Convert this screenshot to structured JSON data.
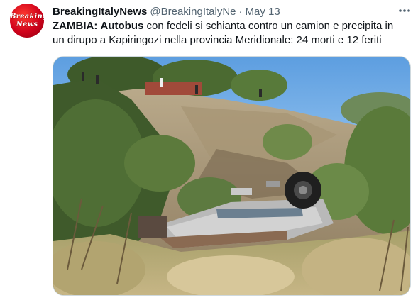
{
  "tweet": {
    "avatar": {
      "line1": "Breaking",
      "line2": "News",
      "color": "#d0021b"
    },
    "display_name": "BreakingItalyNews",
    "handle": "@BreakingItalyNe",
    "separator": "·",
    "date": "May 13",
    "more_icon": "more-horizontal-icon",
    "text": {
      "bold1": "ZAMBIA:",
      "space1": " ",
      "bold2": "Autobus",
      "line1_rest": " con fedeli si schianta contro un camion e precipita in",
      "line2": "un dirupo a Kapiringozi nella provincia Meridionale: 24 morti e 12 feriti"
    },
    "media": {
      "kind": "photo"
    }
  }
}
